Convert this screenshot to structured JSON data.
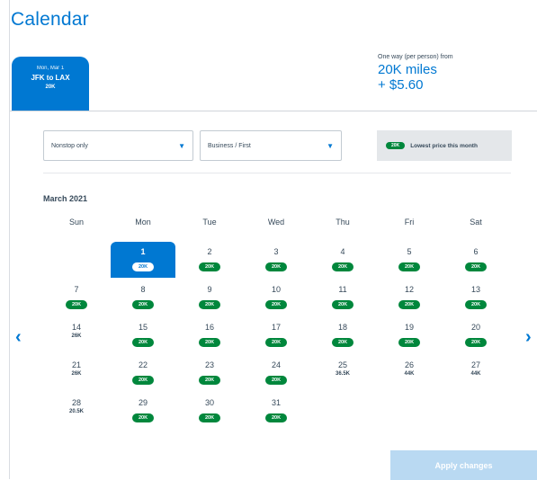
{
  "header": {
    "title": "Calendar"
  },
  "trip_tab": {
    "date": "Mon, Mar 1",
    "route": "JFK to LAX",
    "price": "20K"
  },
  "price_summary": {
    "caption": "One way (per person) from",
    "miles": "20K miles",
    "fee": "+ $5.60"
  },
  "filters": {
    "stops": "Nonstop only",
    "cabin": "Business / First"
  },
  "legend": {
    "pill": "20K",
    "label": "Lowest price this month"
  },
  "month_label": "March 2021",
  "weekdays": [
    "Sun",
    "Mon",
    "Tue",
    "Wed",
    "Thu",
    "Fri",
    "Sat"
  ],
  "days": {
    "d1": {
      "num": "1",
      "price": "20K"
    },
    "d2": {
      "num": "2",
      "price": "20K"
    },
    "d3": {
      "num": "3",
      "price": "20K"
    },
    "d4": {
      "num": "4",
      "price": "20K"
    },
    "d5": {
      "num": "5",
      "price": "20K"
    },
    "d6": {
      "num": "6",
      "price": "20K"
    },
    "d7": {
      "num": "7",
      "price": "20K"
    },
    "d8": {
      "num": "8",
      "price": "20K"
    },
    "d9": {
      "num": "9",
      "price": "20K"
    },
    "d10": {
      "num": "10",
      "price": "20K"
    },
    "d11": {
      "num": "11",
      "price": "20K"
    },
    "d12": {
      "num": "12",
      "price": "20K"
    },
    "d13": {
      "num": "13",
      "price": "20K"
    },
    "d14": {
      "num": "14",
      "price": "26K"
    },
    "d15": {
      "num": "15",
      "price": "20K"
    },
    "d16": {
      "num": "16",
      "price": "20K"
    },
    "d17": {
      "num": "17",
      "price": "20K"
    },
    "d18": {
      "num": "18",
      "price": "20K"
    },
    "d19": {
      "num": "19",
      "price": "20K"
    },
    "d20": {
      "num": "20",
      "price": "20K"
    },
    "d21": {
      "num": "21",
      "price": "26K"
    },
    "d22": {
      "num": "22",
      "price": "20K"
    },
    "d23": {
      "num": "23",
      "price": "20K"
    },
    "d24": {
      "num": "24",
      "price": "20K"
    },
    "d25": {
      "num": "25",
      "price": "36.5K"
    },
    "d26": {
      "num": "26",
      "price": "44K"
    },
    "d27": {
      "num": "27",
      "price": "44K"
    },
    "d28": {
      "num": "28",
      "price": "20.5K"
    },
    "d29": {
      "num": "29",
      "price": "20K"
    },
    "d30": {
      "num": "30",
      "price": "20K"
    },
    "d31": {
      "num": "31",
      "price": "20K"
    }
  },
  "apply_label": "Apply changes",
  "nav": {
    "prev": "‹",
    "next": "›"
  },
  "colors": {
    "accent": "#0078d2",
    "lowest": "#00873c"
  }
}
